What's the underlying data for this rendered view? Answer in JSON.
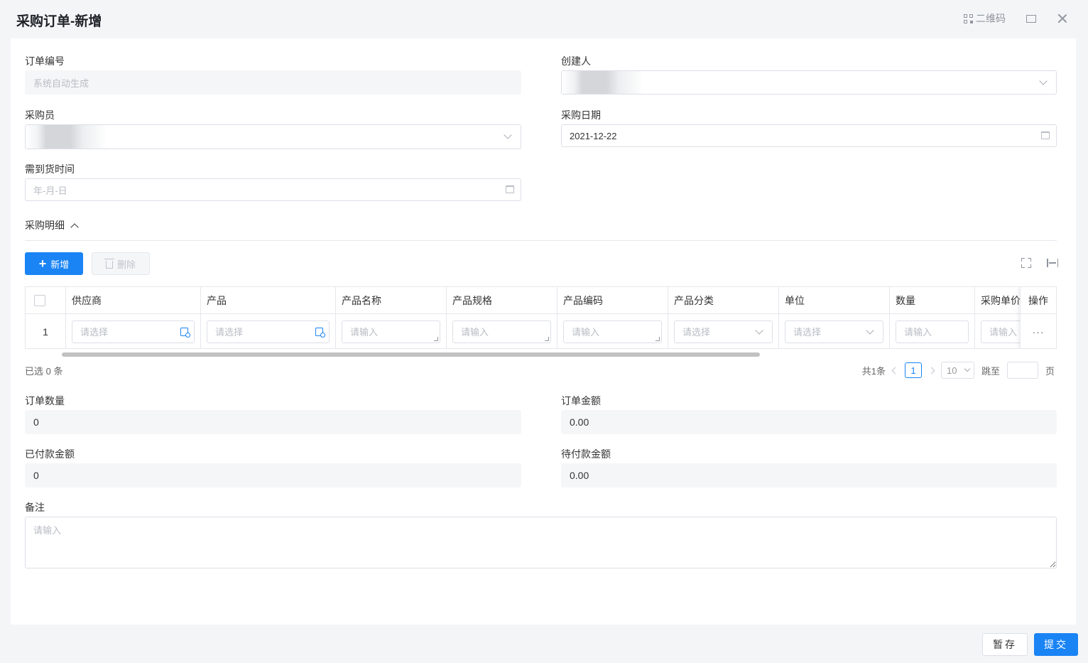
{
  "window": {
    "title": "采购订单-新增",
    "qr_label": "二维码"
  },
  "form": {
    "order_no": {
      "label": "订单编号",
      "placeholder": "系统自动生成"
    },
    "creator": {
      "label": "创建人"
    },
    "buyer": {
      "label": "采购员"
    },
    "purchase_date": {
      "label": "采购日期",
      "value": "2021-12-22"
    },
    "arrival_time": {
      "label": "需到货时间",
      "placeholder": "年-月-日"
    }
  },
  "details": {
    "title": "采购明细",
    "add_label": "新增",
    "delete_label": "删除",
    "columns": [
      "供应商",
      "产品",
      "产品名称",
      "产品规格",
      "产品编码",
      "产品分类",
      "单位",
      "数量",
      "采购单价",
      "操作"
    ],
    "rows": [
      {
        "index": "1",
        "supplier": "请选择",
        "product": "请选择",
        "product_name": "请输入",
        "spec": "请输入",
        "code": "请输入",
        "category": "请选择",
        "unit": "请选择",
        "qty": "请输入",
        "price": "请输入",
        "op": "···"
      }
    ],
    "selected_text": "已选 0 条",
    "pager": {
      "total": "共1条",
      "page": "1",
      "page_size": "10",
      "jump_label": "跳至",
      "page_suffix": "页"
    }
  },
  "summary": {
    "order_qty": {
      "label": "订单数量",
      "value": "0"
    },
    "order_amount": {
      "label": "订单金额",
      "value": "0.00"
    },
    "paid_amount": {
      "label": "已付款金额",
      "value": "0"
    },
    "pending_amount": {
      "label": "待付款金额",
      "value": "0.00"
    }
  },
  "remark": {
    "label": "备注",
    "placeholder": "请输入"
  },
  "footer": {
    "draft_label": "暂存",
    "submit_label": "提交"
  },
  "colors": {
    "primary": "#1a84f5",
    "border": "#dcdfe6",
    "readonly_bg": "#f5f6f8"
  }
}
